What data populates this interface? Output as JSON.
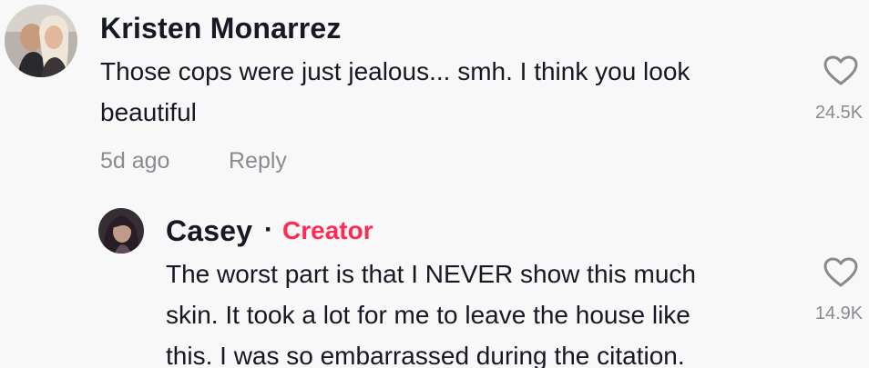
{
  "comments": [
    {
      "author": "Kristen Monarrez",
      "text_lines": [
        "Those cops were just jealous... smh. I think you look",
        "beautiful"
      ],
      "time": "5d ago",
      "reply_label": "Reply",
      "likes": "24.5K",
      "avatar_icon": "user-photo-avatar",
      "like_icon": "heart-outline-icon"
    },
    {
      "author": "Casey",
      "separator": "·",
      "badge": "Creator",
      "text_lines": [
        "The worst part is that I NEVER show this much",
        "skin. It took a lot for me to leave the house like",
        "this. I was so embarrassed during the citation."
      ],
      "likes": "14.9K",
      "avatar_icon": "user-photo-avatar",
      "like_icon": "heart-outline-icon"
    }
  ],
  "colors": {
    "background": "#f8f8f8",
    "text": "#161823",
    "muted": "#8a8b91",
    "creator": "#fe2c55"
  }
}
